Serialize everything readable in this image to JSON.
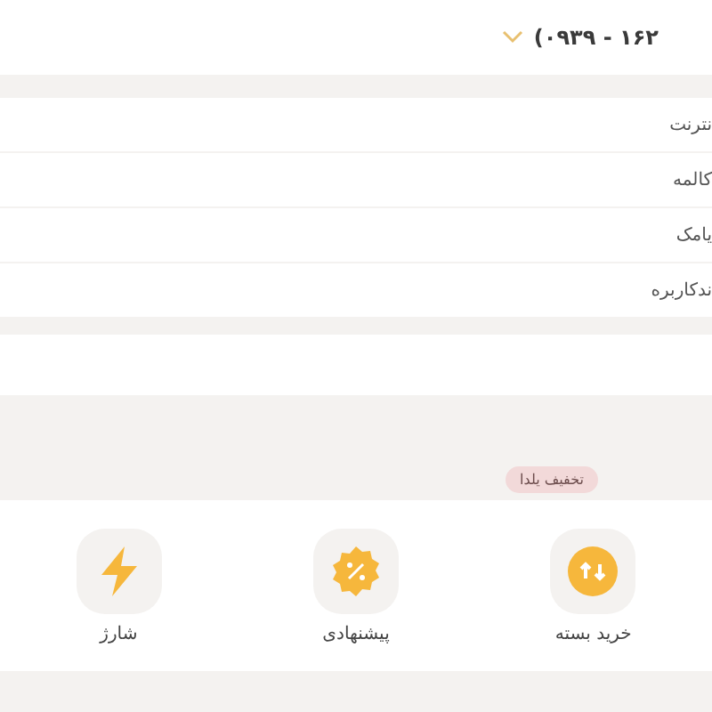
{
  "header": {
    "phone": "۱۶۲ - ۰۹۳۹)"
  },
  "menu": [
    {
      "label": "نترنت"
    },
    {
      "label": "کالمه"
    },
    {
      "label": "یامک"
    },
    {
      "label": "ندکاربره"
    }
  ],
  "promo": {
    "badge": "تخفیف یلدا"
  },
  "shortcuts": [
    {
      "kind": "package",
      "label": "خرید بسته"
    },
    {
      "kind": "offer",
      "label": "پیشنهادی"
    },
    {
      "kind": "charge",
      "label": "شارژ"
    }
  ]
}
